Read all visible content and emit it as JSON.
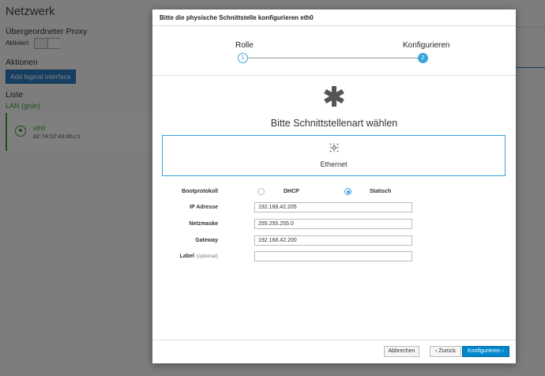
{
  "background": {
    "title": "Netzwerk",
    "proxy_heading": "Übergeordneter Proxy",
    "activated_label": "Aktiviert:",
    "actions_heading": "Aktionen",
    "add_button": "Add logical interface",
    "list_heading": "Liste",
    "lan_label": "LAN (grün)",
    "interface_name": "eth0",
    "interface_mac": "82:74:02:43:85:c1"
  },
  "modal": {
    "title": "Bitte die physische Schnittstelle konfigurieren eth0",
    "steps": [
      {
        "label": "Rolle",
        "number": "1"
      },
      {
        "label": "Konfigurieren",
        "number": "2"
      }
    ],
    "type_heading": "Bitte Schnittstellenart wählen",
    "type_option": "Ethernet",
    "form": {
      "boot_label": "Bootprotokoll",
      "dhcp_label": "DHCP",
      "static_label": "Statisch",
      "ip_label": "IP Adresse",
      "ip_value": "192.168.42.205",
      "netmask_label": "Netzmaske",
      "netmask_value": "255.255.255.0",
      "gateway_label": "Gateway",
      "gateway_value": "192.168.42.200",
      "label_label": "Label",
      "label_optional": "(optional)",
      "label_value": ""
    },
    "footer": {
      "cancel": "Abbrechen",
      "back": "‹ Zurück",
      "next": "Konfigurieren ›"
    }
  },
  "colors": {
    "accent": "#39a5dc",
    "primary_button": "#0088ce",
    "green": "#3f9c35"
  }
}
